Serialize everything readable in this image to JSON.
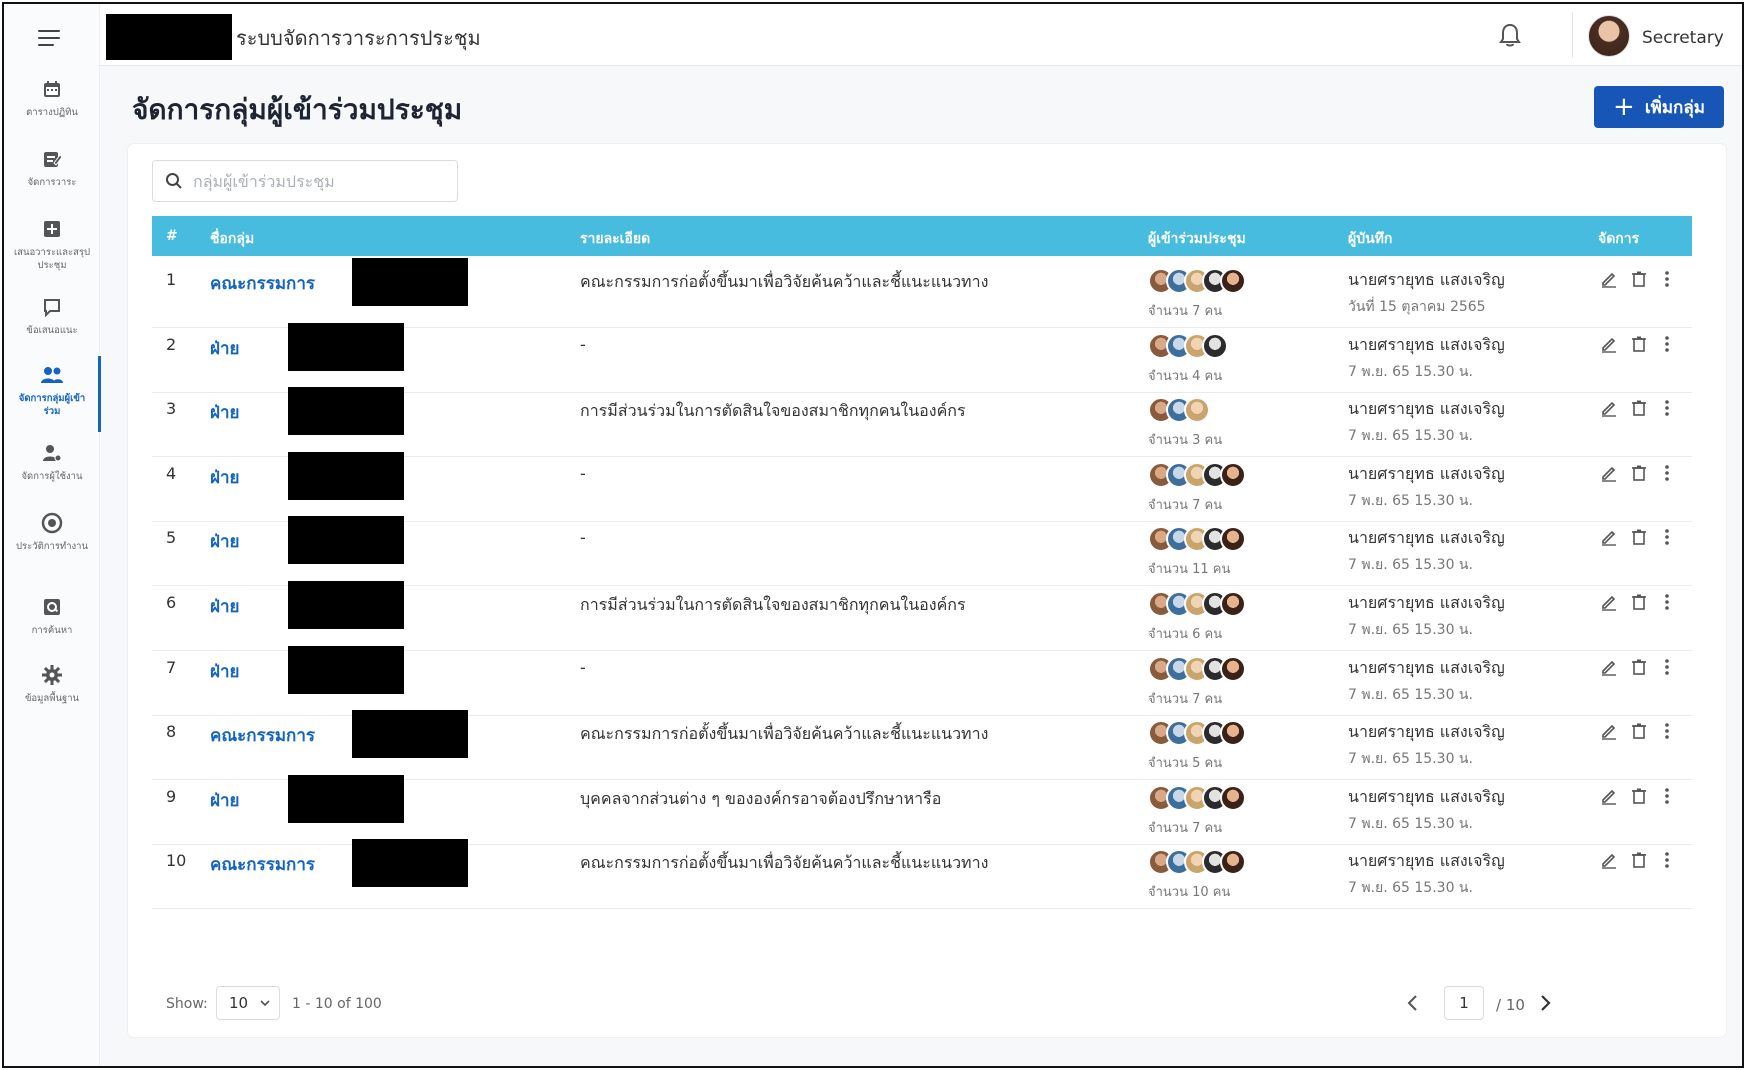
{
  "app": {
    "title": "ระบบจัดการวาระการประชุม",
    "user_name": "Secretary"
  },
  "sidebar": {
    "items": [
      {
        "label": "ตารางปฏิทิน",
        "icon": "calendar-icon"
      },
      {
        "label": "จัดการวาระ",
        "icon": "edit-note-icon"
      },
      {
        "label": "เสนอวาระและสรุปประชุม",
        "icon": "add-note-icon"
      },
      {
        "label": "ข้อเสนอแนะ",
        "icon": "comment-icon"
      },
      {
        "label": "จัดการกลุ่มผู้เข้าร่วม",
        "icon": "group-icon",
        "active": true
      },
      {
        "label": "จัดการผู้ใช้งาน",
        "icon": "user-manage-icon"
      },
      {
        "label": "ประวัติการทำงาน",
        "icon": "history-icon"
      },
      {
        "label": "การค้นหา",
        "icon": "search-doc-icon"
      },
      {
        "label": "ข้อมูลพื้นฐาน",
        "icon": "settings-icon"
      }
    ]
  },
  "page": {
    "title": "จัดการกลุ่มผู้เข้าร่วมประชุม",
    "add_button": "เพิ่มกลุ่ม",
    "search_placeholder": "กลุ่มผู้เข้าร่วมประชุม"
  },
  "table": {
    "headers": {
      "num": "#",
      "name": "ชื่อกลุ่ม",
      "desc": "รายละเอียด",
      "members": "ผู้เข้าร่วมประชุม",
      "recorder": "ผู้บันทึก",
      "actions": "จัดการ"
    },
    "rows": [
      {
        "num": "1",
        "name": "คณะกรรมการ",
        "desc": "คณะกรรมการก่อตั้งขึ้นมาเพื่อวิจัยค้นคว้าและชี้แนะแนวทาง",
        "count": "จำนวน 7 คน",
        "recorder": "นายศรายุทธ แสงเจริญ",
        "date": "วันที่ 15 ตุลาคม 2565"
      },
      {
        "num": "2",
        "name": "ฝ่าย",
        "desc": "-",
        "count": "จำนวน 4 คน",
        "recorder": "นายศรายุทธ แสงเจริญ",
        "date": "7 พ.ย. 65 15.30 น."
      },
      {
        "num": "3",
        "name": "ฝ่าย",
        "desc": "การมีส่วนร่วมในการตัดสินใจของสมาชิกทุกคนในองค์กร",
        "count": "จำนวน 3 คน",
        "recorder": "นายศรายุทธ แสงเจริญ",
        "date": "7 พ.ย. 65 15.30 น."
      },
      {
        "num": "4",
        "name": "ฝ่าย",
        "desc": "-",
        "count": "จำนวน 7 คน",
        "recorder": "นายศรายุทธ แสงเจริญ",
        "date": "7 พ.ย. 65 15.30 น."
      },
      {
        "num": "5",
        "name": "ฝ่าย",
        "desc": "-",
        "count": "จำนวน 11 คน",
        "recorder": "นายศรายุทธ แสงเจริญ",
        "date": "7 พ.ย. 65 15.30 น."
      },
      {
        "num": "6",
        "name": "ฝ่าย",
        "desc": "การมีส่วนร่วมในการตัดสินใจของสมาชิกทุกคนในองค์กร",
        "count": "จำนวน 6 คน",
        "recorder": "นายศรายุทธ แสงเจริญ",
        "date": "7 พ.ย. 65 15.30 น."
      },
      {
        "num": "7",
        "name": "ฝ่าย",
        "desc": "-",
        "count": "จำนวน 7 คน",
        "recorder": "นายศรายุทธ แสงเจริญ",
        "date": "7 พ.ย. 65 15.30 น."
      },
      {
        "num": "8",
        "name": "คณะกรรมการ",
        "desc": "คณะกรรมการก่อตั้งขึ้นมาเพื่อวิจัยค้นคว้าและชี้แนะแนวทาง",
        "count": "จำนวน 5 คน",
        "recorder": "นายศรายุทธ แสงเจริญ",
        "date": "7 พ.ย. 65 15.30 น."
      },
      {
        "num": "9",
        "name": "ฝ่าย",
        "desc": "บุคคลจากส่วนต่าง ๆ ขององค์กรอาจต้องปรึกษาหารือ",
        "count": "จำนวน 7 คน",
        "recorder": "นายศรายุทธ แสงเจริญ",
        "date": "7 พ.ย. 65 15.30 น."
      },
      {
        "num": "10",
        "name": "คณะกรรมการ",
        "desc": "คณะกรรมการก่อตั้งขึ้นมาเพื่อวิจัยค้นคว้าและชี้แนะแนวทาง",
        "count": "จำนวน 10 คน",
        "recorder": "นายศรายุทธ แสงเจริญ",
        "date": "7 พ.ย. 65 15.30 น."
      }
    ]
  },
  "pagination": {
    "show_label": "Show:",
    "page_size": "10",
    "range": "1 - 10 of 100",
    "current_page": "1",
    "total_pages": "/ 10"
  },
  "colors": {
    "primary": "#1756b7",
    "header_bar": "#47bcdf",
    "link": "#1565c0"
  }
}
